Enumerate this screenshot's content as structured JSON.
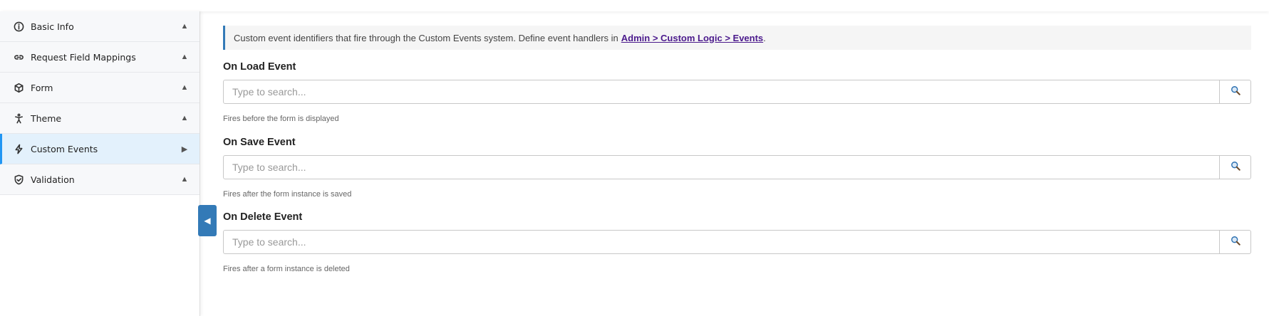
{
  "sidebar": {
    "items": [
      {
        "label": "Basic Info",
        "icon": "info-circle-icon",
        "caret": "▲"
      },
      {
        "label": "Request Field Mappings",
        "icon": "link-icon",
        "caret": "▲"
      },
      {
        "label": "Form",
        "icon": "cube-icon",
        "caret": "▲"
      },
      {
        "label": "Theme",
        "icon": "accessibility-icon",
        "caret": "▲"
      },
      {
        "label": "Custom Events",
        "icon": "bolt-icon",
        "caret": "▶"
      },
      {
        "label": "Validation",
        "icon": "shield-check-icon",
        "caret": "▲"
      }
    ],
    "active_item": "Custom Events",
    "collapse_glyph": "◀"
  },
  "info": {
    "text": "Custom event identifiers that fire through the Custom Events system. Define event handlers in",
    "link_text": "Admin > Custom Logic > Events",
    "suffix": "."
  },
  "fields": [
    {
      "label": "On Load Event",
      "placeholder": "Type to search...",
      "value": "",
      "help": "Fires before the form is displayed"
    },
    {
      "label": "On Save Event",
      "placeholder": "Type to search...",
      "value": "",
      "help": "Fires after the form instance is saved"
    },
    {
      "label": "On Delete Event",
      "placeholder": "Type to search...",
      "value": "",
      "help": "Fires after a form instance is deleted"
    }
  ],
  "colors": {
    "accent": "#337ab7",
    "active_bg": "#e3f1fc",
    "active_border": "#2196f3",
    "link": "#4b1a8c"
  }
}
